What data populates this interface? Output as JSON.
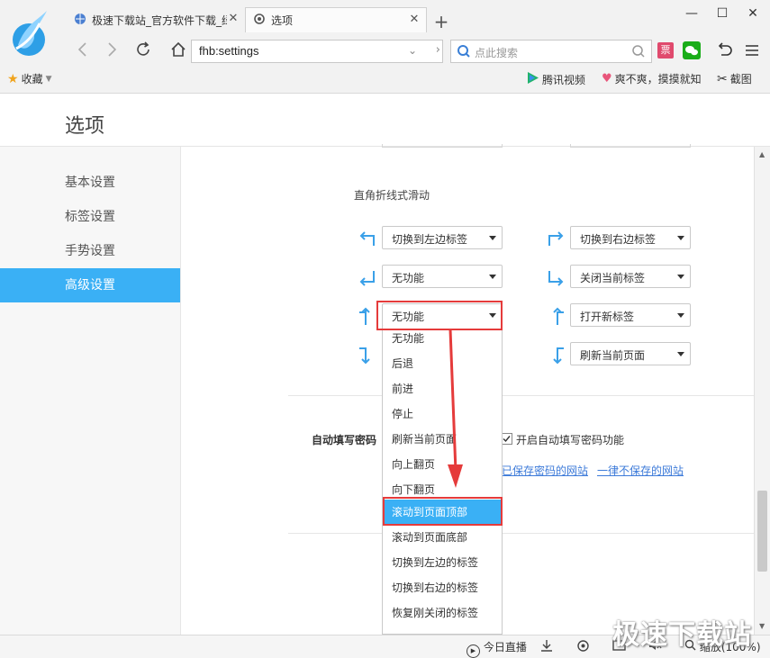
{
  "browser": {
    "tabs": [
      {
        "title": "极速下载站_官方软件下载_绿",
        "active": false
      },
      {
        "title": "选项",
        "active": true
      }
    ],
    "new_tab": "+",
    "window": {
      "minimize": "—",
      "maximize": "☐",
      "close": "✕"
    },
    "address": {
      "url": "fhb:settings"
    },
    "search": {
      "placeholder": "点此搜索"
    },
    "ticket_label": "票",
    "bookmarks": {
      "favorites_label": "收藏",
      "items": [
        "腾讯视频",
        "爽不爽，摸摸就知",
        "截图"
      ]
    }
  },
  "page": {
    "title": "选项",
    "sidebar": {
      "items": [
        {
          "label": "基本设置",
          "active": false
        },
        {
          "label": "标签设置",
          "active": false
        },
        {
          "label": "手势设置",
          "active": false
        },
        {
          "label": "高级设置",
          "active": true
        }
      ]
    },
    "gestures": {
      "section_title": "直角折线式滑动",
      "left_selects": [
        "切换到左边标签",
        "无功能",
        "无功能"
      ],
      "right_selects": [
        "切换到右边标签",
        "关闭当前标签",
        "打开新标签",
        "刷新当前页面"
      ]
    },
    "autofill": {
      "label": "自动填写密码",
      "checkbox_label": "开启自动填写密码功能",
      "checked": true,
      "link_saved": "已保存密码的网站",
      "link_never": "一律不保存的网站"
    },
    "dropdown": {
      "options": [
        "无功能",
        "后退",
        "前进",
        "停止",
        "刷新当前页面",
        "向上翻页",
        "向下翻页",
        "滚动到页面顶部",
        "滚动到页面底部",
        "切换到左边的标签",
        "切换到右边的标签",
        "恢复刚关闭的标签"
      ],
      "highlighted_index": 7
    }
  },
  "statusbar": {
    "live_label": "今日直播",
    "zoom_label": "缩放(100%)"
  },
  "watermark": "极速下载站",
  "colors": {
    "accent": "#3ab0f5",
    "annotation_red": "#e53b3b",
    "gesture_arrow": "#3aa0e8"
  }
}
